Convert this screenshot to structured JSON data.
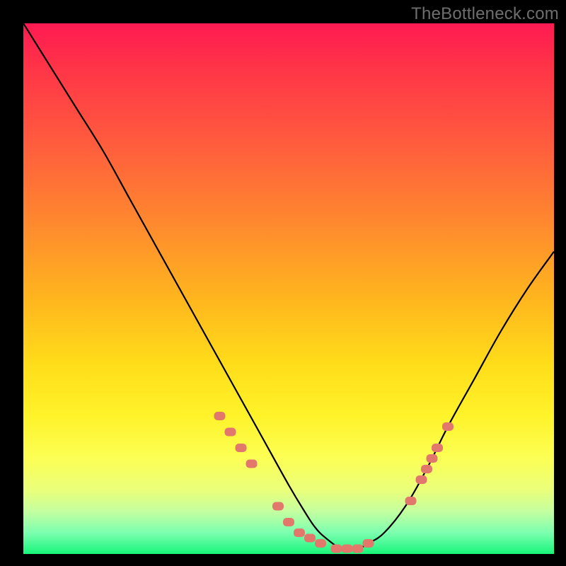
{
  "watermark": "TheBottleneck.com",
  "colors": {
    "background": "#000000",
    "gradient_top": "#ff1a52",
    "gradient_bottom": "#17f57a",
    "curve": "#000000",
    "marker": "#e2786c"
  },
  "chart_data": {
    "type": "line",
    "title": "",
    "xlabel": "",
    "ylabel": "",
    "xlim": [
      0,
      100
    ],
    "ylim": [
      0,
      100
    ],
    "grid": false,
    "legend": false,
    "series": [
      {
        "name": "bottleneck-curve",
        "x": [
          0,
          5,
          10,
          15,
          20,
          25,
          30,
          35,
          40,
          45,
          50,
          53,
          55,
          57,
          60,
          63,
          65,
          68,
          72,
          76,
          80,
          85,
          90,
          95,
          100
        ],
        "y": [
          100,
          92,
          84,
          76,
          67,
          58,
          49,
          40,
          31,
          22,
          13,
          8,
          5,
          3,
          1,
          1,
          2,
          4,
          9,
          16,
          24,
          33,
          42,
          50,
          57
        ]
      }
    ],
    "markers": {
      "name": "highlighted-points",
      "x": [
        37,
        39,
        41,
        43,
        48,
        50,
        52,
        54,
        56,
        59,
        61,
        63,
        65,
        73,
        75,
        76,
        77,
        78,
        80
      ],
      "y": [
        26,
        23,
        20,
        17,
        9,
        6,
        4,
        3,
        2,
        1,
        1,
        1,
        2,
        10,
        14,
        16,
        18,
        20,
        24
      ]
    }
  }
}
